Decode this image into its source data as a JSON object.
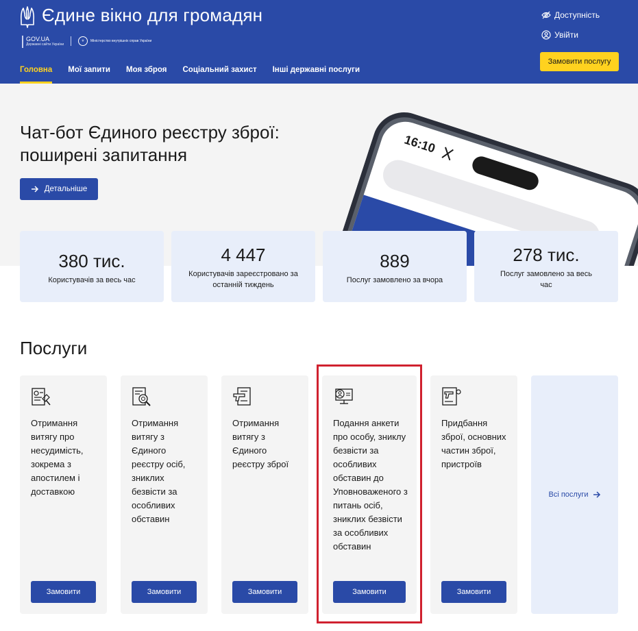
{
  "header": {
    "title": "Єдине вікно для громадян",
    "govua_main": "GOV.UA",
    "govua_sub": "Державні сайти України",
    "ministry_name": "Міністерство внутрішніх справ України",
    "accessibility_label": "Доступність",
    "login_label": "Увійти",
    "order_button": "Замовити послугу"
  },
  "nav": [
    {
      "label": "Головна",
      "active": true
    },
    {
      "label": "Мої запити",
      "active": false
    },
    {
      "label": "Моя зброя",
      "active": false
    },
    {
      "label": "Соціальний захист",
      "active": false
    },
    {
      "label": "Інші державні послуги",
      "active": false
    }
  ],
  "hero": {
    "title_line1": "Чат-бот Єдиного реєстру зброї:",
    "title_line2": "поширені запитання",
    "button": "Детальніше",
    "phone_time": "16:10"
  },
  "stats": [
    {
      "value": "380 тис.",
      "label": "Користувачів за весь час"
    },
    {
      "value": "4 447",
      "label": "Користувачів зареєстровано за останній тиждень"
    },
    {
      "value": "889",
      "label": "Послуг замовлено за вчора"
    },
    {
      "value": "278 тис.",
      "label": "Послуг замовлено за весь час"
    }
  ],
  "services": {
    "title": "Послуги",
    "items": [
      {
        "icon": "certificate-stamp-icon",
        "text": "Отримання витягу про несудимість, зокрема з апостилем і доставкою",
        "button": "Замовити"
      },
      {
        "icon": "document-search-icon",
        "text": "Отримання витягу з Єдиного реєстру осіб, зниклих безвісти за особливих обставин",
        "button": "Замовити"
      },
      {
        "icon": "weapon-document-icon",
        "text": "Отримання витягу з Єдиного реєстру зброї",
        "button": "Замовити"
      },
      {
        "icon": "person-monitor-icon",
        "text": "Подання анкети про особу, зниклу безвісти за особливих обставин до Уповноваженого з питань осіб, зниклих безвісти за особливих обставин",
        "button": "Замовити"
      },
      {
        "icon": "pistol-document-icon",
        "text": "Придбання зброї, основних частин зброї, пристроїв",
        "button": "Замовити"
      }
    ],
    "all_services": "Всі послуги"
  },
  "colors": {
    "primary": "#2a4aa7",
    "accent": "#ffd21f",
    "highlight": "#d0212f"
  }
}
